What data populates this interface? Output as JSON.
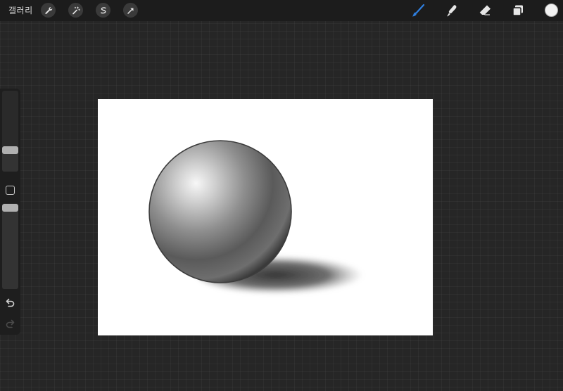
{
  "topbar": {
    "gallery_label": "갤러리",
    "left_tools": [
      {
        "name": "wrench-icon",
        "tool": "actions"
      },
      {
        "name": "magic-wand-icon",
        "tool": "adjustments"
      },
      {
        "name": "selection-s-icon",
        "tool": "selection"
      },
      {
        "name": "arrow-cursor-icon",
        "tool": "transform"
      }
    ],
    "right_tools": [
      {
        "name": "brush-icon",
        "tool": "paint",
        "active": true
      },
      {
        "name": "smudge-icon",
        "tool": "smudge"
      },
      {
        "name": "eraser-icon",
        "tool": "erase"
      },
      {
        "name": "layers-icon",
        "tool": "layers"
      }
    ],
    "current_color": "#f2f2f2",
    "active_color": "#2f7fe0"
  },
  "sidebar": {
    "brush_size_level": 0.27,
    "opacity_level": 0.95,
    "modify_icon": "square-icon",
    "undo_icon": "undo-icon",
    "redo_icon": "redo-icon"
  },
  "canvas": {
    "background": "#ffffff",
    "artwork": "shaded-sphere-drawing"
  }
}
